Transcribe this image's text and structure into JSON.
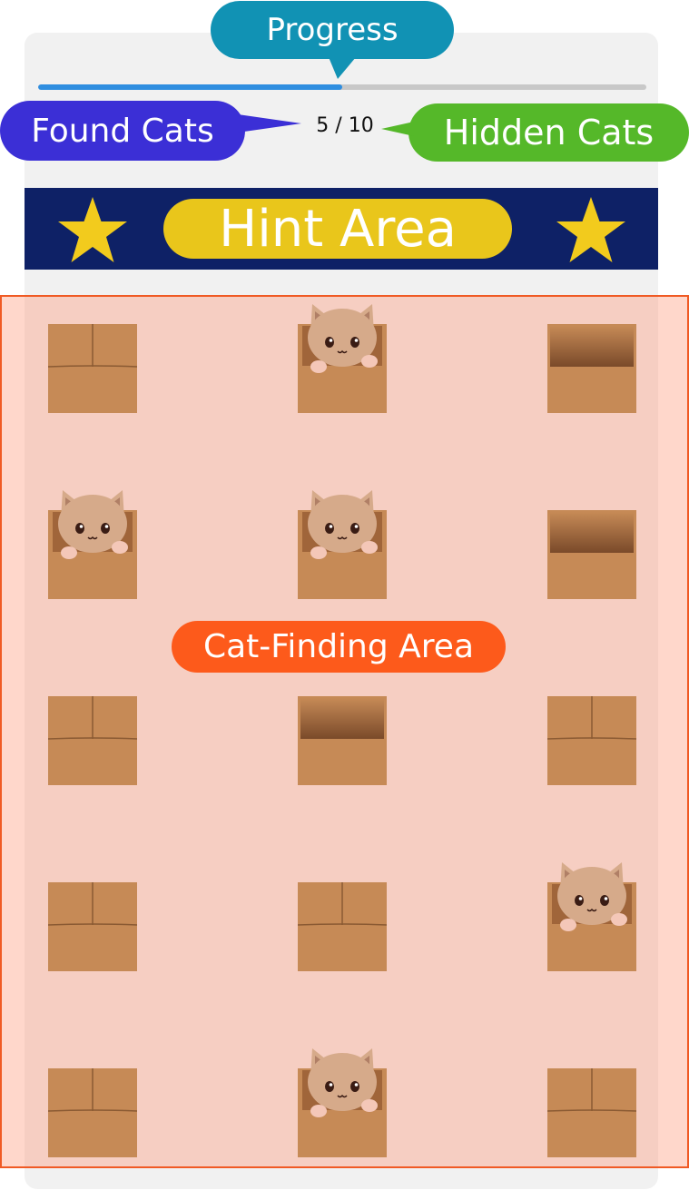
{
  "callouts": {
    "progress": "Progress",
    "found": "Found Cats",
    "hidden": "Hidden Cats",
    "hint": "Hint Area",
    "finding_area": "Cat-Finding Area"
  },
  "progress": {
    "found": 5,
    "total": 10,
    "fraction": 0.5,
    "label": "5 / 10"
  },
  "colors": {
    "progress_fill": "#2f8ee0",
    "hint_bar": "#0e2166",
    "hint_pill": "#e9c61b",
    "star": "#f2cb1d",
    "box": "#c68a56",
    "cat": "#d6aa8a",
    "finding_area_border": "#f05a24"
  },
  "grid": {
    "rows": 5,
    "cols": 3,
    "cells": [
      [
        "closed",
        "cat",
        "open"
      ],
      [
        "cat",
        "cat",
        "open"
      ],
      [
        "closed",
        "open",
        "closed"
      ],
      [
        "closed",
        "closed",
        "cat"
      ],
      [
        "closed",
        "cat",
        "closed"
      ]
    ]
  },
  "icons": {
    "star": "star-icon",
    "box": "box-icon",
    "cat": "cat-icon"
  }
}
